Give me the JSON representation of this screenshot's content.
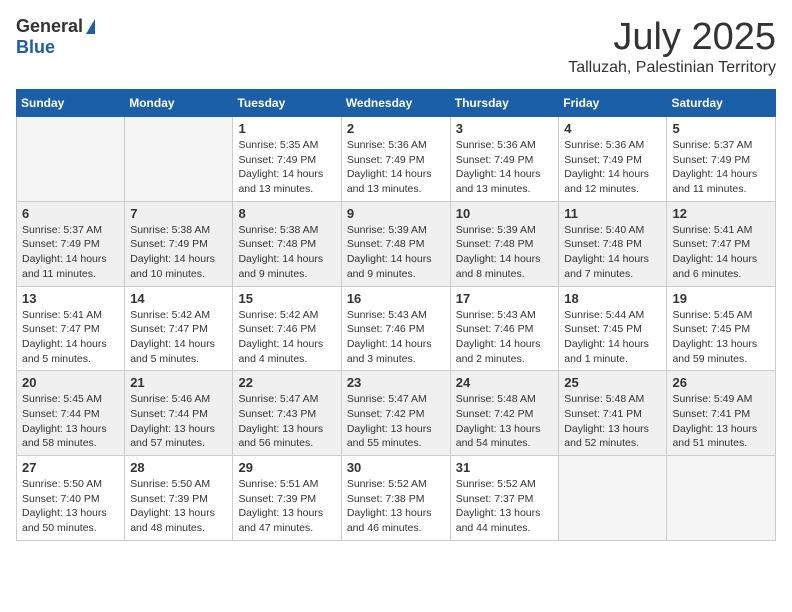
{
  "header": {
    "logo_general": "General",
    "logo_blue": "Blue",
    "month": "July 2025",
    "location": "Talluzah, Palestinian Territory"
  },
  "days_of_week": [
    "Sunday",
    "Monday",
    "Tuesday",
    "Wednesday",
    "Thursday",
    "Friday",
    "Saturday"
  ],
  "weeks": [
    [
      {
        "day": "",
        "empty": true
      },
      {
        "day": "",
        "empty": true
      },
      {
        "day": "1",
        "sunrise": "Sunrise: 5:35 AM",
        "sunset": "Sunset: 7:49 PM",
        "daylight": "Daylight: 14 hours and 13 minutes."
      },
      {
        "day": "2",
        "sunrise": "Sunrise: 5:36 AM",
        "sunset": "Sunset: 7:49 PM",
        "daylight": "Daylight: 14 hours and 13 minutes."
      },
      {
        "day": "3",
        "sunrise": "Sunrise: 5:36 AM",
        "sunset": "Sunset: 7:49 PM",
        "daylight": "Daylight: 14 hours and 13 minutes."
      },
      {
        "day": "4",
        "sunrise": "Sunrise: 5:36 AM",
        "sunset": "Sunset: 7:49 PM",
        "daylight": "Daylight: 14 hours and 12 minutes."
      },
      {
        "day": "5",
        "sunrise": "Sunrise: 5:37 AM",
        "sunset": "Sunset: 7:49 PM",
        "daylight": "Daylight: 14 hours and 11 minutes."
      }
    ],
    [
      {
        "day": "6",
        "sunrise": "Sunrise: 5:37 AM",
        "sunset": "Sunset: 7:49 PM",
        "daylight": "Daylight: 14 hours and 11 minutes."
      },
      {
        "day": "7",
        "sunrise": "Sunrise: 5:38 AM",
        "sunset": "Sunset: 7:49 PM",
        "daylight": "Daylight: 14 hours and 10 minutes."
      },
      {
        "day": "8",
        "sunrise": "Sunrise: 5:38 AM",
        "sunset": "Sunset: 7:48 PM",
        "daylight": "Daylight: 14 hours and 9 minutes."
      },
      {
        "day": "9",
        "sunrise": "Sunrise: 5:39 AM",
        "sunset": "Sunset: 7:48 PM",
        "daylight": "Daylight: 14 hours and 9 minutes."
      },
      {
        "day": "10",
        "sunrise": "Sunrise: 5:39 AM",
        "sunset": "Sunset: 7:48 PM",
        "daylight": "Daylight: 14 hours and 8 minutes."
      },
      {
        "day": "11",
        "sunrise": "Sunrise: 5:40 AM",
        "sunset": "Sunset: 7:48 PM",
        "daylight": "Daylight: 14 hours and 7 minutes."
      },
      {
        "day": "12",
        "sunrise": "Sunrise: 5:41 AM",
        "sunset": "Sunset: 7:47 PM",
        "daylight": "Daylight: 14 hours and 6 minutes."
      }
    ],
    [
      {
        "day": "13",
        "sunrise": "Sunrise: 5:41 AM",
        "sunset": "Sunset: 7:47 PM",
        "daylight": "Daylight: 14 hours and 5 minutes."
      },
      {
        "day": "14",
        "sunrise": "Sunrise: 5:42 AM",
        "sunset": "Sunset: 7:47 PM",
        "daylight": "Daylight: 14 hours and 5 minutes."
      },
      {
        "day": "15",
        "sunrise": "Sunrise: 5:42 AM",
        "sunset": "Sunset: 7:46 PM",
        "daylight": "Daylight: 14 hours and 4 minutes."
      },
      {
        "day": "16",
        "sunrise": "Sunrise: 5:43 AM",
        "sunset": "Sunset: 7:46 PM",
        "daylight": "Daylight: 14 hours and 3 minutes."
      },
      {
        "day": "17",
        "sunrise": "Sunrise: 5:43 AM",
        "sunset": "Sunset: 7:46 PM",
        "daylight": "Daylight: 14 hours and 2 minutes."
      },
      {
        "day": "18",
        "sunrise": "Sunrise: 5:44 AM",
        "sunset": "Sunset: 7:45 PM",
        "daylight": "Daylight: 14 hours and 1 minute."
      },
      {
        "day": "19",
        "sunrise": "Sunrise: 5:45 AM",
        "sunset": "Sunset: 7:45 PM",
        "daylight": "Daylight: 13 hours and 59 minutes."
      }
    ],
    [
      {
        "day": "20",
        "sunrise": "Sunrise: 5:45 AM",
        "sunset": "Sunset: 7:44 PM",
        "daylight": "Daylight: 13 hours and 58 minutes."
      },
      {
        "day": "21",
        "sunrise": "Sunrise: 5:46 AM",
        "sunset": "Sunset: 7:44 PM",
        "daylight": "Daylight: 13 hours and 57 minutes."
      },
      {
        "day": "22",
        "sunrise": "Sunrise: 5:47 AM",
        "sunset": "Sunset: 7:43 PM",
        "daylight": "Daylight: 13 hours and 56 minutes."
      },
      {
        "day": "23",
        "sunrise": "Sunrise: 5:47 AM",
        "sunset": "Sunset: 7:42 PM",
        "daylight": "Daylight: 13 hours and 55 minutes."
      },
      {
        "day": "24",
        "sunrise": "Sunrise: 5:48 AM",
        "sunset": "Sunset: 7:42 PM",
        "daylight": "Daylight: 13 hours and 54 minutes."
      },
      {
        "day": "25",
        "sunrise": "Sunrise: 5:48 AM",
        "sunset": "Sunset: 7:41 PM",
        "daylight": "Daylight: 13 hours and 52 minutes."
      },
      {
        "day": "26",
        "sunrise": "Sunrise: 5:49 AM",
        "sunset": "Sunset: 7:41 PM",
        "daylight": "Daylight: 13 hours and 51 minutes."
      }
    ],
    [
      {
        "day": "27",
        "sunrise": "Sunrise: 5:50 AM",
        "sunset": "Sunset: 7:40 PM",
        "daylight": "Daylight: 13 hours and 50 minutes."
      },
      {
        "day": "28",
        "sunrise": "Sunrise: 5:50 AM",
        "sunset": "Sunset: 7:39 PM",
        "daylight": "Daylight: 13 hours and 48 minutes."
      },
      {
        "day": "29",
        "sunrise": "Sunrise: 5:51 AM",
        "sunset": "Sunset: 7:39 PM",
        "daylight": "Daylight: 13 hours and 47 minutes."
      },
      {
        "day": "30",
        "sunrise": "Sunrise: 5:52 AM",
        "sunset": "Sunset: 7:38 PM",
        "daylight": "Daylight: 13 hours and 46 minutes."
      },
      {
        "day": "31",
        "sunrise": "Sunrise: 5:52 AM",
        "sunset": "Sunset: 7:37 PM",
        "daylight": "Daylight: 13 hours and 44 minutes."
      },
      {
        "day": "",
        "empty": true
      },
      {
        "day": "",
        "empty": true
      }
    ]
  ]
}
